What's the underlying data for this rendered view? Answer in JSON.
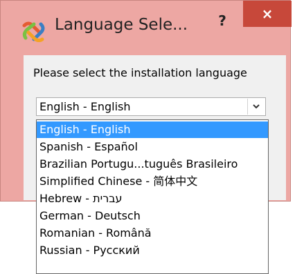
{
  "window": {
    "title": "Language Sele...",
    "help_label": "?",
    "close_label": "×"
  },
  "prompt": "Please select the installation language",
  "combo": {
    "selected": "English - English"
  },
  "dropdown": {
    "items": [
      "English - English",
      "Spanish - Español",
      "Brazilian Portugu...tuguês Brasileiro",
      "Simplified Chinese - 简体中文",
      "Hebrew - עברית",
      "German - Deutsch",
      "Romanian - Română",
      "Russian - Русский"
    ],
    "selected_index": 0
  },
  "colors": {
    "titlebar": "#eda7a3",
    "close_button": "#c7483a",
    "selection": "#3399ff"
  }
}
